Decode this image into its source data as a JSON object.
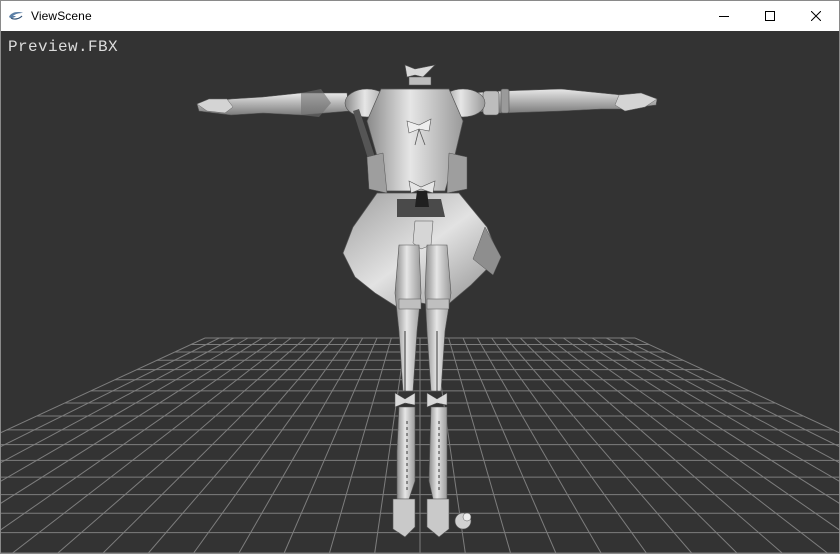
{
  "window": {
    "title": "ViewScene",
    "icons": {
      "app": "viewscene-app-icon",
      "minimize": "minimize-icon",
      "maximize": "maximize-icon",
      "close": "close-icon"
    }
  },
  "viewport": {
    "file_label": "Preview.FBX",
    "background_color": "#333333",
    "grid_color": "#8a8a8a",
    "model_color": "#c8c8c8"
  }
}
